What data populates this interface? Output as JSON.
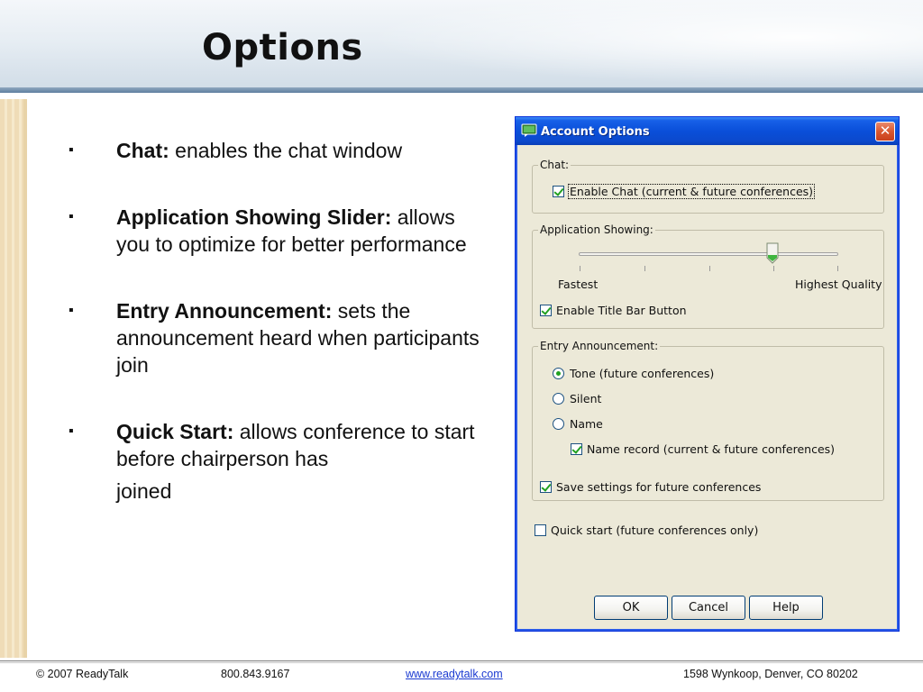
{
  "slide": {
    "title": "Options",
    "bullets": [
      {
        "marker": "▪",
        "bold": "Chat:",
        "text": " enables the chat window",
        "tail": ""
      },
      {
        "marker": "▪",
        "bold": "Application Showing Slider:",
        "text": " allows you to optimize for better performance",
        "tail": ""
      },
      {
        "marker": "▪",
        "bold": "Entry Announcement:",
        "text": " sets the announcement heard when participants join",
        "tail": ""
      },
      {
        "marker": "▪",
        "bold": "Quick Start:",
        "text": " allows conference to start before chairperson has",
        "tail": "joined"
      }
    ]
  },
  "dialog": {
    "title": "Account Options",
    "close_label": "✕",
    "chat": {
      "group_label": "Chat:",
      "enable_chat": {
        "label": "Enable Chat (current & future conferences)",
        "checked": true
      }
    },
    "app_showing": {
      "group_label": "Application Showing:",
      "slider_value": 0.75,
      "min_label": "Fastest",
      "max_label": "Highest Quality",
      "title_bar_button": {
        "label": "Enable Title Bar Button",
        "checked": true
      }
    },
    "entry": {
      "group_label": "Entry Announcement:",
      "tone": {
        "label": "Tone (future conferences)",
        "selected": true
      },
      "silent": {
        "label": "Silent",
        "selected": false
      },
      "name": {
        "label": "Name",
        "selected": false
      },
      "name_record": {
        "label": "Name record (current & future conferences)",
        "checked": true
      },
      "save_settings": {
        "label": "Save settings for future conferences",
        "checked": true
      }
    },
    "quick_start": {
      "label": "Quick start (future conferences only)",
      "checked": false
    },
    "buttons": {
      "ok": "OK",
      "cancel": "Cancel",
      "help": "Help"
    }
  },
  "footer": {
    "copyright": "© 2007 ReadyTalk",
    "phone": "800.843.9167",
    "website": "www.readytalk.com",
    "address": "1598 Wynkoop, Denver, CO 80202"
  },
  "colors": {
    "titlebar": "#0a4fd9",
    "dialog_bg": "#ece9d8",
    "check_green": "#21a121",
    "link_blue": "#1a3ad1"
  }
}
